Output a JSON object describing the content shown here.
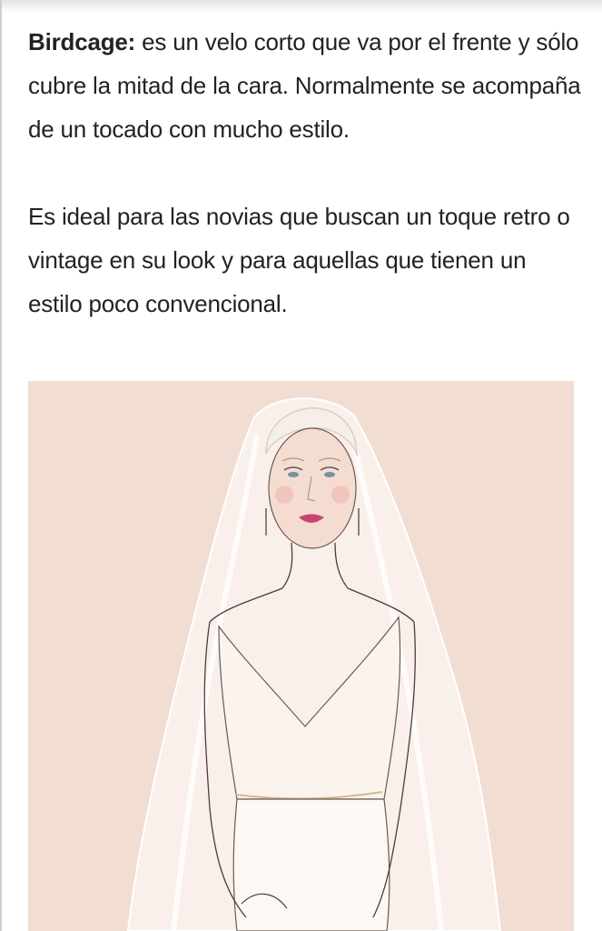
{
  "article": {
    "term": "Birdcage:",
    "definition": " es un velo corto que va por el frente y sólo cubre la mitad de la cara. Normalmente se acompaña de un tocado con mucho estilo.",
    "paragraph_2": "Es ideal para las novias que buscan un toque retro o vintage en su look y para aquellas que tienen un estilo poco convencional."
  },
  "illustration": {
    "subject": "bride-with-veil-sketch",
    "background_color": "#f2ddd2"
  }
}
